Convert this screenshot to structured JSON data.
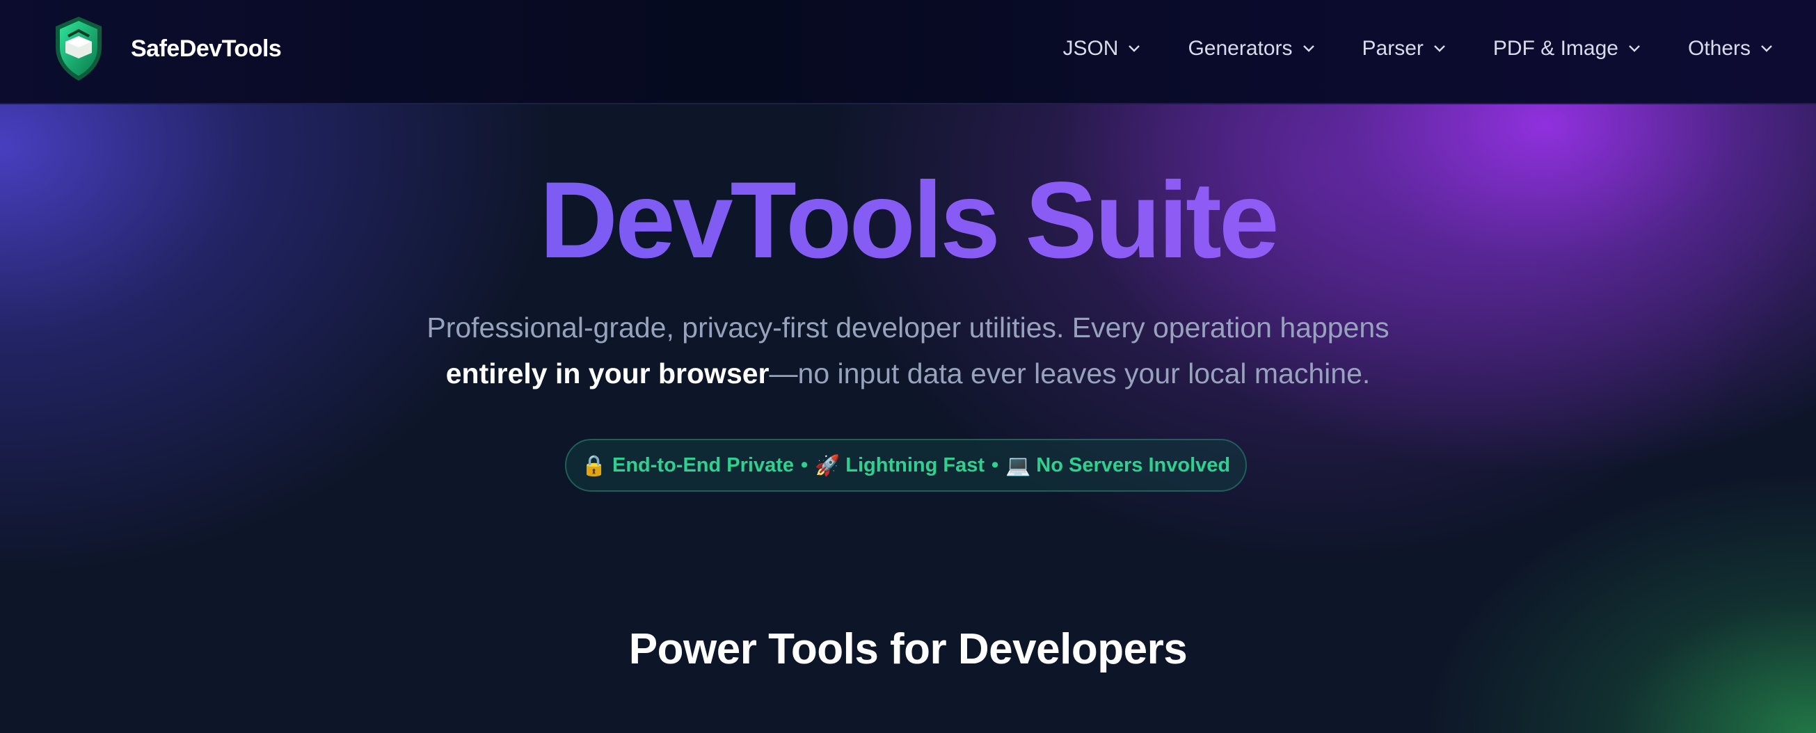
{
  "header": {
    "brand_name": "SafeDevTools",
    "logo_icon": "shield-logo-icon",
    "nav": [
      {
        "label": "JSON",
        "icon": "chevron-down-icon"
      },
      {
        "label": "Generators",
        "icon": "chevron-down-icon"
      },
      {
        "label": "Parser",
        "icon": "chevron-down-icon"
      },
      {
        "label": "PDF & Image",
        "icon": "chevron-down-icon"
      },
      {
        "label": "Others",
        "icon": "chevron-down-icon"
      }
    ]
  },
  "hero": {
    "title": "DevTools Suite",
    "subtitle_line1": "Professional-grade, privacy-first developer utilities. Every operation happens",
    "subtitle_strong": "entirely in your browser",
    "subtitle_line2_rest": "—no input data ever leaves your local machine.",
    "badge": {
      "item1_emoji": "🔒",
      "item1": "End-to-End Private",
      "item2_emoji": "🚀",
      "item2": "Lightning Fast",
      "item3_emoji": "💻",
      "item3": "No Servers Involved",
      "separator": "•"
    }
  },
  "section": {
    "title": "Power Tools for Developers"
  },
  "colors": {
    "accent_purple": "#8c5cf5",
    "badge_green": "#2fd18e",
    "header_bg": "#0b0c2e",
    "page_bg": "#0d1528"
  }
}
